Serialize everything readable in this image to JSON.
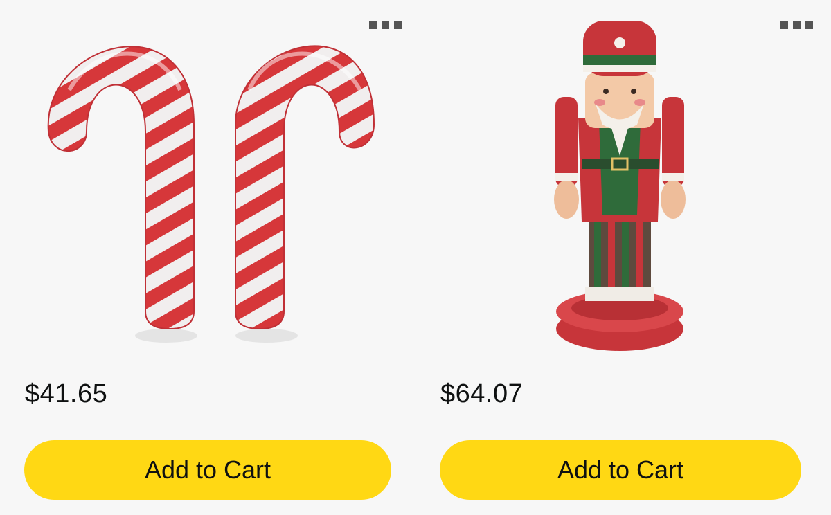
{
  "products": [
    {
      "image_alt": "inflatable candy canes",
      "price": "$41.65",
      "add_to_cart_label": "Add to Cart",
      "more_icon": "more-options-icon"
    },
    {
      "image_alt": "inflatable nutcracker",
      "price": "$64.07",
      "add_to_cart_label": "Add to Cart",
      "more_icon": "more-options-icon"
    }
  ],
  "colors": {
    "background": "#f7f7f7",
    "button": "#ffd814",
    "candy_red": "#d6373a",
    "nutcracker_green": "#2f6b3a"
  }
}
